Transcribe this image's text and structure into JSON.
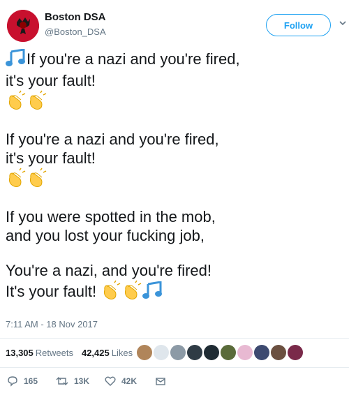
{
  "account": {
    "name": "Boston DSA",
    "handle": "@Boston_DSA",
    "follow_label": "Follow"
  },
  "tweet": {
    "lines": [
      "If you're a nazi and you're fired,",
      "it's your fault!",
      "If you're a nazi and you're fired,",
      "it's your fault!",
      "If you were spotted in the mob,",
      "and you lost your fucking job,",
      "You're a nazi, and you're fired!",
      "It's your fault!"
    ],
    "emojis": [
      "musical-notes",
      "clapping-hands"
    ]
  },
  "meta": {
    "timestamp": "7:11 AM - 18 Nov 2017"
  },
  "stats": {
    "retweets_count": "13,305",
    "retweets_label": "Retweets",
    "likes_count": "42,425",
    "likes_label": "Likes"
  },
  "actions": {
    "replies": "165",
    "retweets": "13K",
    "likes": "42K"
  },
  "colors": {
    "accent": "#1da1f2",
    "muted": "#657786",
    "avatar_bg": "#c8102e"
  }
}
